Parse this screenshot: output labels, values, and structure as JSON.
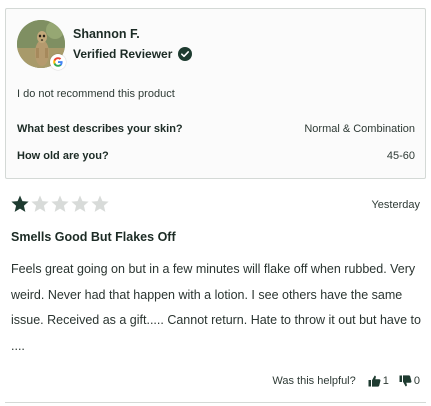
{
  "reviewer": {
    "name": "Shannon F.",
    "badge": "Verified Reviewer",
    "avatar_icon": "meerkat-photo",
    "source_icon": "google-g-icon"
  },
  "review_meta": {
    "recommendation": "I do not recommend this product",
    "questions": [
      {
        "label": "What best describes your skin?",
        "value": "Normal & Combination"
      },
      {
        "label": "How old are you?",
        "value": "45-60"
      }
    ]
  },
  "review": {
    "rating": 1,
    "max_rating": 5,
    "date": "Yesterday",
    "title": "Smells Good But Flakes Off",
    "body": "Feels great going on but in a few minutes will flake off when rubbed. Very weird. Never had that happen with a lotion. I see others have the same issue. Received as a gift..... Cannot return. Hate to throw it out but have to ...."
  },
  "helpful": {
    "label": "Was this helpful?",
    "up_count": "1",
    "down_count": "0"
  },
  "colors": {
    "star_filled": "#1e3b30",
    "star_empty": "#d8dbd9",
    "verified_badge": "#1e3b30",
    "text": "#1c2b25"
  }
}
